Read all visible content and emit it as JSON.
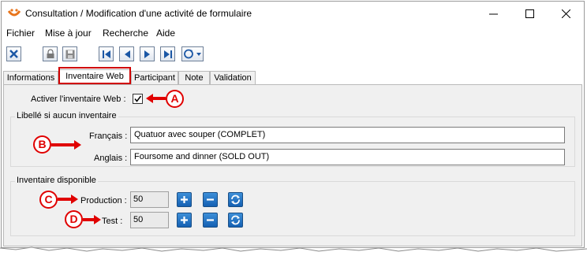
{
  "window": {
    "title": "Consultation / Modification d'une activité de formulaire"
  },
  "menu": [
    "Fichier",
    "Mise à jour",
    "Recherche",
    "Aide"
  ],
  "toolbar": {
    "icons": [
      "close-icon",
      "lock-icon",
      "save-icon",
      "first-record-icon",
      "previous-record-icon",
      "next-record-icon",
      "last-record-icon",
      "refresh-dropdown-icon"
    ]
  },
  "tabs": [
    "Informations",
    "Inventaire Web",
    "Participant",
    "Note",
    "Validation"
  ],
  "active_tab": "Inventaire Web",
  "form": {
    "activer_label": "Activer l'inventaire Web :",
    "activer_checked": true,
    "libelle_group_title": "Libellé si aucun inventaire",
    "francais_label": "Français :",
    "francais_value": "Quatuor avec souper (COMPLET)",
    "anglais_label": "Anglais :",
    "anglais_value": "Foursome and dinner (SOLD OUT)",
    "inventaire_group_title": "Inventaire disponible",
    "production_label": "Production :",
    "production_value": "50",
    "test_label": "Test :",
    "test_value": "50"
  },
  "callouts": [
    "A",
    "B",
    "C",
    "D"
  ],
  "colors": {
    "callout": "#e00000",
    "button_blue": "#1460b3"
  }
}
